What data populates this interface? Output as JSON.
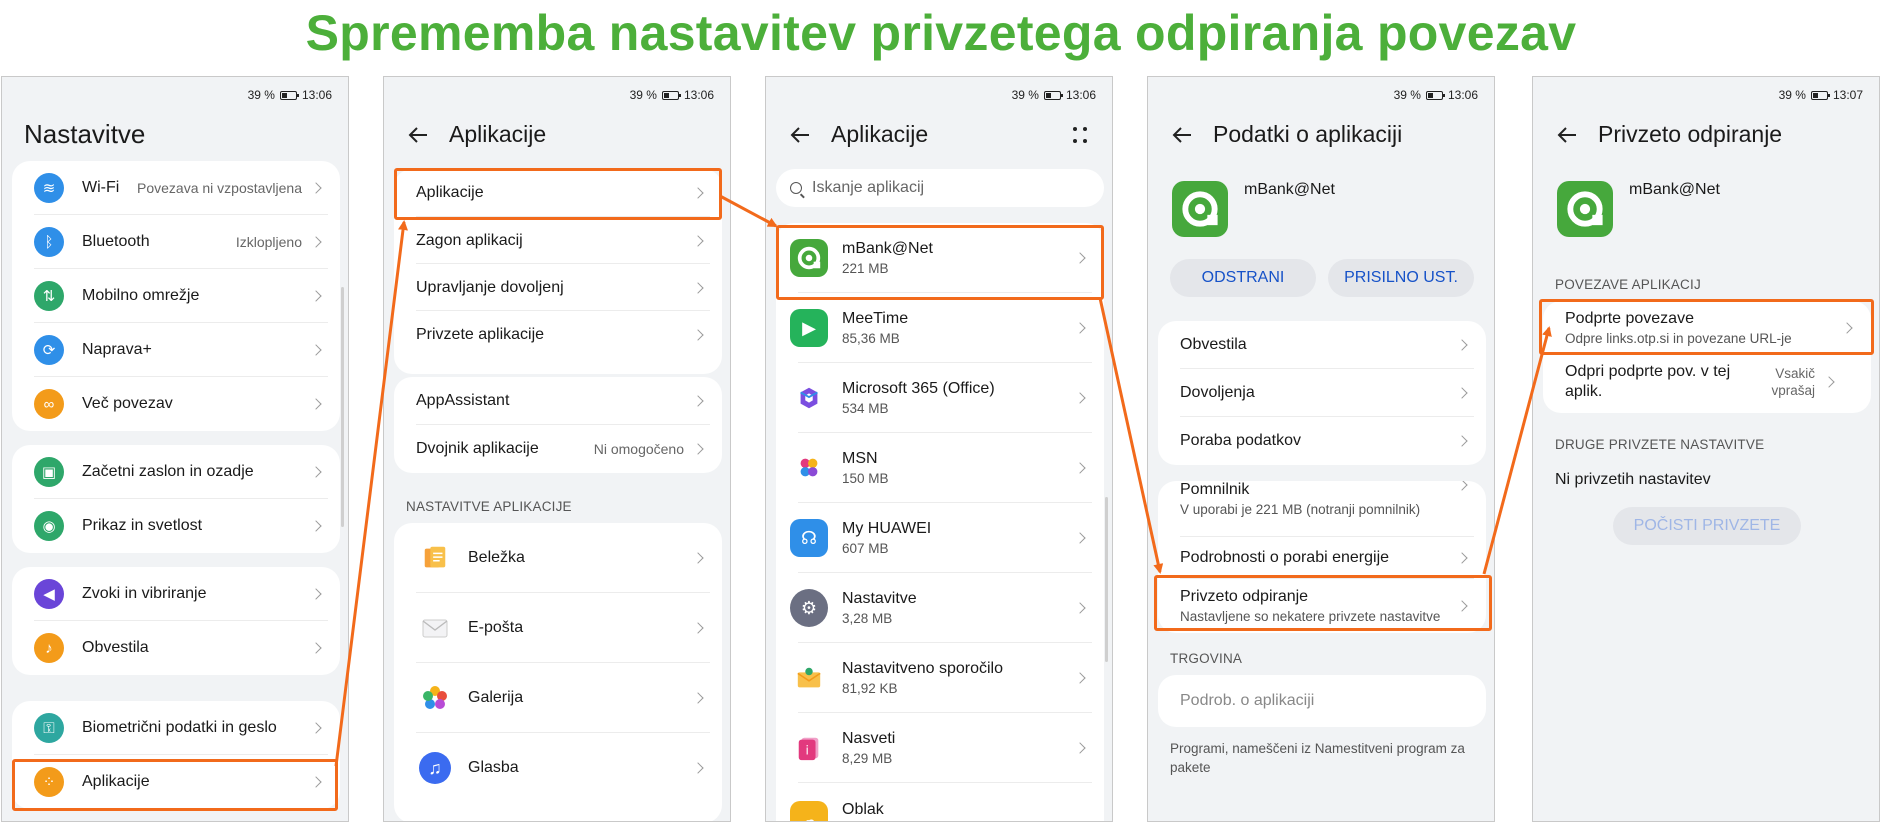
{
  "title": "Sprememba nastavitev privzetega odpiranja povezav",
  "accent_color": "#f26a1b",
  "title_color": "#4caf3a",
  "status": [
    {
      "battery": "39 %",
      "time": "13:06"
    },
    {
      "battery": "39 %",
      "time": "13:06"
    },
    {
      "battery": "39 %",
      "time": "13:06"
    },
    {
      "battery": "39 %",
      "time": "13:06"
    },
    {
      "battery": "39 %",
      "time": "13:07"
    }
  ],
  "screen1": {
    "title": "Nastavitve",
    "group1": [
      {
        "label": "Wi-Fi",
        "value": "Povezava ni vzpostavljena",
        "icon": "wifi-icon"
      },
      {
        "label": "Bluetooth",
        "value": "Izklopljeno",
        "icon": "bluetooth-icon"
      },
      {
        "label": "Mobilno omrežje",
        "value": "",
        "icon": "mobile-network-icon"
      },
      {
        "label": "Naprava+",
        "value": "",
        "icon": "device-plus-icon"
      },
      {
        "label": "Več povezav",
        "value": "",
        "icon": "link-icon"
      }
    ],
    "group2": [
      {
        "label": "Začetni zaslon in ozadje",
        "icon": "wallpaper-icon"
      },
      {
        "label": "Prikaz in svetlost",
        "icon": "eye-icon"
      }
    ],
    "group3": [
      {
        "label": "Zvoki in vibriranje",
        "icon": "sound-icon"
      },
      {
        "label": "Obvestila",
        "icon": "bell-icon"
      }
    ],
    "group4": [
      {
        "label": "Biometrični podatki in geslo",
        "icon": "key-icon"
      },
      {
        "label": "Aplikacije",
        "icon": "apps-icon"
      }
    ]
  },
  "screen2": {
    "title": "Aplikacije",
    "group1": [
      "Aplikacije",
      "Zagon aplikacij",
      "Upravljanje dovoljenj",
      "Privzete aplikacije"
    ],
    "group2": [
      {
        "label": "AppAssistant",
        "value": ""
      },
      {
        "label": "Dvojnik aplikacije",
        "value": "Ni omogočeno"
      }
    ],
    "section": "NASTAVITVE APLIKACIJE",
    "apps": [
      "Beležka",
      "E-pošta",
      "Galerija",
      "Glasba"
    ]
  },
  "screen3": {
    "title": "Aplikacije",
    "search_placeholder": "Iskanje aplikacij",
    "apps": [
      {
        "name": "mBank@Net",
        "size": "221 MB",
        "icon": "mbank-icon"
      },
      {
        "name": "MeeTime",
        "size": "85,36 MB",
        "icon": "meetime-icon"
      },
      {
        "name": "Microsoft 365 (Office)",
        "size": "534 MB",
        "icon": "microsoft365-icon"
      },
      {
        "name": "MSN",
        "size": "150 MB",
        "icon": "msn-icon"
      },
      {
        "name": "My HUAWEI",
        "size": "607 MB",
        "icon": "my-huawei-icon"
      },
      {
        "name": "Nastavitve",
        "size": "3,28 MB",
        "icon": "settings-icon"
      },
      {
        "name": "Nastavitveno sporočilo",
        "size": "81,92 KB",
        "icon": "config-message-icon"
      },
      {
        "name": "Nasveti",
        "size": "8,29 MB",
        "icon": "tips-icon"
      },
      {
        "name": "Oblak",
        "size": "",
        "icon": "cloud-icon"
      }
    ]
  },
  "screen4": {
    "title": "Podatki o aplikaciji",
    "app_name": "mBank@Net",
    "uninstall": "ODSTRANI",
    "force_stop": "PRISILNO UST.",
    "group1": [
      "Obvestila",
      "Dovoljenja",
      "Poraba podatkov"
    ],
    "storage_label": "Pomnilnik",
    "storage_sub": "V uporabi je 221 MB (notranji pomnilnik)",
    "energy": "Podrobnosti o porabi energije",
    "default_label": "Privzeto odpiranje",
    "default_sub": "Nastavljene so nekatere privzete nastavitve",
    "store_section": "TRGOVINA",
    "store_item": "Podrob. o aplikaciji",
    "store_note": "Programi, nameščeni iz Namestitveni program za pakete"
  },
  "screen5": {
    "title": "Privzeto odpiranje",
    "app_name": "mBank@Net",
    "section1": "POVEZAVE APLIKACIJ",
    "supported_label": "Podprte povezave",
    "supported_sub": "Odpre links.otp.si in povezane URL-je",
    "open_label": "Odpri podprte pov. v tej aplik.",
    "open_value": "Vsakič vprašaj",
    "section2": "DRUGE PRIVZETE NASTAVITVE",
    "none": "Ni privzetih nastavitev",
    "clear": "POČISTI PRIVZETE"
  }
}
